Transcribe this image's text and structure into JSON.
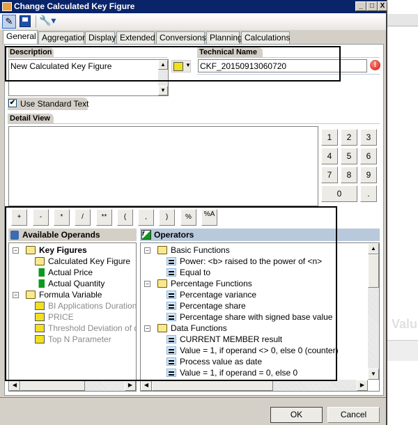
{
  "window": {
    "title": "Change Calculated Key Figure",
    "minimize": "_",
    "maximize": "□",
    "close": "X"
  },
  "icons": {
    "app": "app-grid-icon",
    "edit": "pencil-icon",
    "save": "floppy-disk-icon",
    "tools": "wrench-icon",
    "error": "error-exclamation-icon"
  },
  "tabs": [
    {
      "label": "General",
      "active": true
    },
    {
      "label": "Aggregation"
    },
    {
      "label": "Display"
    },
    {
      "label": "Extended"
    },
    {
      "label": "Conversions"
    },
    {
      "label": "Planning"
    },
    {
      "label": "Calculations"
    }
  ],
  "description": {
    "label": "Description",
    "value": "New Calculated Key Figure",
    "use_standard_text": "Use Standard Text",
    "use_standard_checked": true
  },
  "technical": {
    "label": "Technical Name",
    "value": "CKF_20150913060720"
  },
  "detail": {
    "label": "Detail View",
    "value": ""
  },
  "keypad": [
    "1",
    "2",
    "3",
    "4",
    "5",
    "6",
    "7",
    "8",
    "9",
    "0",
    "."
  ],
  "operator_buttons": [
    "+",
    "-",
    "*",
    "/",
    "**",
    "(",
    ",",
    ")",
    "%",
    "%A"
  ],
  "operands": {
    "title": "Available Operands",
    "items": [
      {
        "label": "Key Figures",
        "level": 0,
        "type": "folder",
        "bold": true
      },
      {
        "label": "Calculated Key Figure",
        "level": 1,
        "type": "folder"
      },
      {
        "label": "Actual Price",
        "level": 1,
        "type": "keyfigure"
      },
      {
        "label": "Actual Quantity",
        "level": 1,
        "type": "keyfigure"
      },
      {
        "label": "Formula Variable",
        "level": 0,
        "type": "folder"
      },
      {
        "label": "BI Applications Duration from",
        "level": 1,
        "type": "variable",
        "disabled": true
      },
      {
        "label": "PRICE",
        "level": 1,
        "type": "variable",
        "disabled": true
      },
      {
        "label": "Threshold Deviation of durati",
        "level": 1,
        "type": "variable",
        "disabled": true
      },
      {
        "label": "Top N Parameter",
        "level": 1,
        "type": "variable",
        "disabled": true
      }
    ]
  },
  "operators": {
    "title": "Operators",
    "items": [
      {
        "label": "Basic Functions",
        "level": 0,
        "type": "folder"
      },
      {
        "label": "Power: <b> raised to the power of <n>",
        "level": 1,
        "type": "func"
      },
      {
        "label": "Equal to",
        "level": 1,
        "type": "func"
      },
      {
        "label": "Percentage Functions",
        "level": 0,
        "type": "folder"
      },
      {
        "label": "Percentage variance",
        "level": 1,
        "type": "func"
      },
      {
        "label": "Percentage share",
        "level": 1,
        "type": "func"
      },
      {
        "label": "Percentage share with signed base value",
        "level": 1,
        "type": "func"
      },
      {
        "label": "Data Functions",
        "level": 0,
        "type": "folder"
      },
      {
        "label": "CURRENT MEMBER result",
        "level": 1,
        "type": "func"
      },
      {
        "label": "Value = 1, if operand <> 0, else 0 (counter)",
        "level": 1,
        "type": "func"
      },
      {
        "label": "Process value as date",
        "level": 1,
        "type": "func"
      },
      {
        "label": "Value = 1, if operand = 0, else 0",
        "level": 1,
        "type": "func"
      }
    ]
  },
  "footer": {
    "ok": "OK",
    "cancel": "Cancel"
  },
  "background_text": "Valu"
}
